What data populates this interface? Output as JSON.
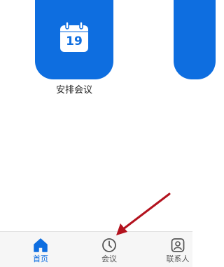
{
  "tiles": [
    {
      "label": "安排会议",
      "icon": "calendar-icon",
      "calendar_day": "19"
    }
  ],
  "bottom_nav": {
    "items": [
      {
        "label": "首页",
        "icon": "home-icon",
        "active": true
      },
      {
        "label": "会议",
        "icon": "clock-icon",
        "active": false
      },
      {
        "label": "联系人",
        "icon": "contact-icon",
        "active": false
      }
    ]
  },
  "colors": {
    "accent": "#0e6ee0",
    "arrow": "#b3121e",
    "nav_background": "#f6f6f6"
  }
}
